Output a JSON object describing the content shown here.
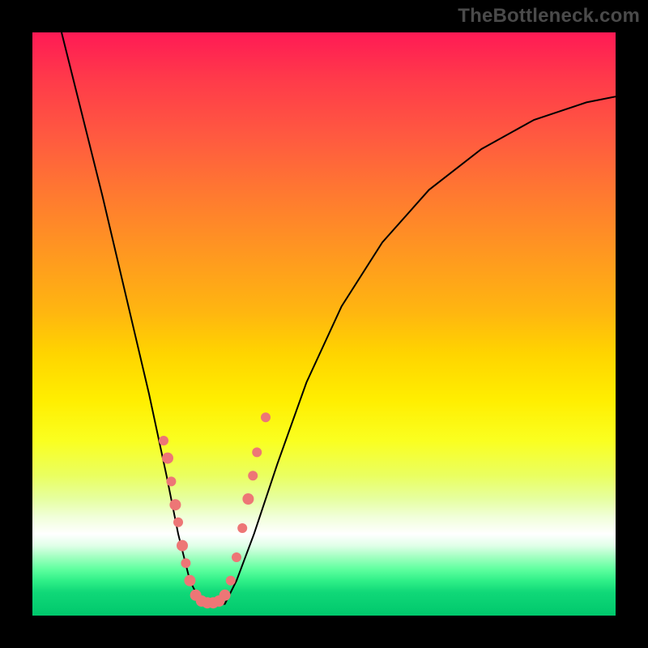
{
  "watermark": "TheBottleneck.com",
  "colors": {
    "dot": "#ed7676",
    "curve": "#000000",
    "background": "#000000"
  },
  "chart_data": {
    "type": "line",
    "title": "",
    "xlabel": "",
    "ylabel": "",
    "xlim": [
      0,
      100
    ],
    "ylim": [
      0,
      100
    ],
    "grid": false,
    "legend": false,
    "notes": "No axis tick labels are visible; x/y values are estimated in percent of the plotting area. The curve is a V-shaped bottleneck curve with a flat minimum band near x≈27–33 and y≈2, rising steeply on both sides. The colored background is a vertical red→green gradient (high=bad, low=good).",
    "series": [
      {
        "name": "bottleneck-curve",
        "x": [
          5,
          8,
          12,
          16,
          20,
          23,
          25,
          27,
          29,
          31,
          33,
          35,
          38,
          42,
          47,
          53,
          60,
          68,
          77,
          86,
          95,
          100
        ],
        "y": [
          100,
          88,
          72,
          55,
          38,
          24,
          14,
          6,
          2,
          2,
          2,
          6,
          14,
          26,
          40,
          53,
          64,
          73,
          80,
          85,
          88,
          89
        ]
      }
    ],
    "scatter_points": {
      "name": "sample-dots",
      "points": [
        {
          "x": 22.5,
          "y": 30,
          "r": 6
        },
        {
          "x": 23.2,
          "y": 27,
          "r": 7
        },
        {
          "x": 23.8,
          "y": 23,
          "r": 6
        },
        {
          "x": 24.5,
          "y": 19,
          "r": 7
        },
        {
          "x": 25.0,
          "y": 16,
          "r": 6
        },
        {
          "x": 25.7,
          "y": 12,
          "r": 7
        },
        {
          "x": 26.3,
          "y": 9,
          "r": 6
        },
        {
          "x": 27.0,
          "y": 6,
          "r": 7
        },
        {
          "x": 28.0,
          "y": 3.5,
          "r": 7
        },
        {
          "x": 29.0,
          "y": 2.5,
          "r": 7
        },
        {
          "x": 30.0,
          "y": 2.2,
          "r": 7
        },
        {
          "x": 31.0,
          "y": 2.2,
          "r": 7
        },
        {
          "x": 32.0,
          "y": 2.5,
          "r": 7
        },
        {
          "x": 33.0,
          "y": 3.5,
          "r": 7
        },
        {
          "x": 34.0,
          "y": 6,
          "r": 6
        },
        {
          "x": 35.0,
          "y": 10,
          "r": 6
        },
        {
          "x": 36.0,
          "y": 15,
          "r": 6
        },
        {
          "x": 37.0,
          "y": 20,
          "r": 7
        },
        {
          "x": 37.8,
          "y": 24,
          "r": 6
        },
        {
          "x": 38.5,
          "y": 28,
          "r": 6
        },
        {
          "x": 40.0,
          "y": 34,
          "r": 6
        }
      ]
    }
  }
}
